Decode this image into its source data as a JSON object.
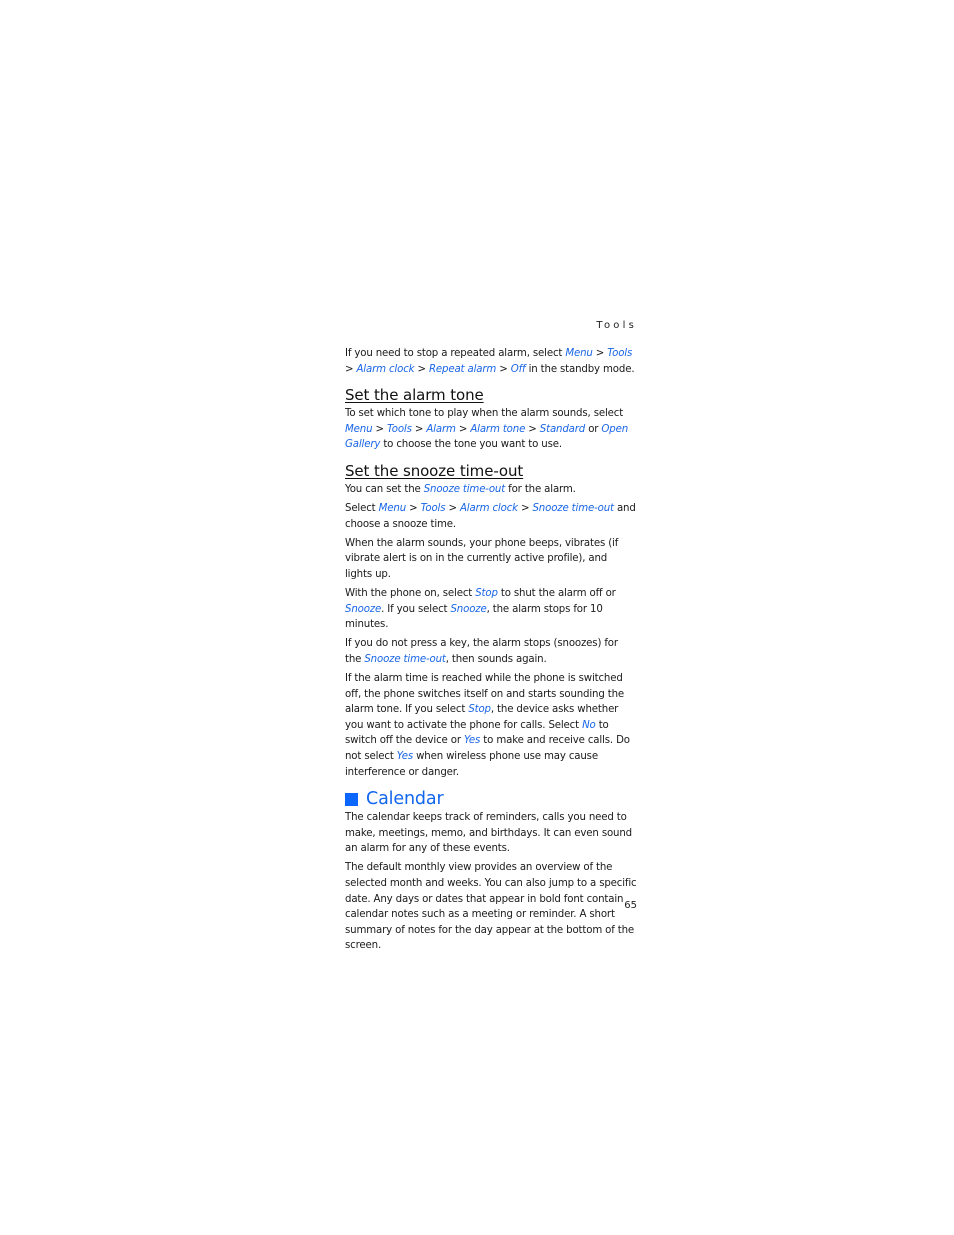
{
  "running_head": "Tools",
  "page_number": "65",
  "link_color": "#1a66e6",
  "accent_color": "#0a66ff",
  "intro": [
    {
      "t": "If you need to stop a repeated alarm, select "
    },
    {
      "l": "Menu"
    },
    {
      "t": " > "
    },
    {
      "l": "Tools"
    },
    {
      "t": " > "
    },
    {
      "l": "Alarm clock"
    },
    {
      "t": " > "
    },
    {
      "l": "Repeat alarm"
    },
    {
      "t": " > "
    },
    {
      "l": "Off"
    },
    {
      "t": " in the standby mode."
    }
  ],
  "sections": [
    {
      "heading": "Set the alarm tone",
      "paragraphs": [
        [
          {
            "t": "To set which tone to play when the alarm sounds, select "
          },
          {
            "l": "Menu"
          },
          {
            "t": " > "
          },
          {
            "l": "Tools"
          },
          {
            "t": " > "
          },
          {
            "l": "Alarm"
          },
          {
            "t": " > "
          },
          {
            "l": "Alarm tone"
          },
          {
            "t": " > "
          },
          {
            "l": "Standard"
          },
          {
            "t": " or "
          },
          {
            "l": "Open Gallery"
          },
          {
            "t": " to choose the tone you want to use."
          }
        ]
      ]
    },
    {
      "heading": "Set the snooze time-out",
      "paragraphs": [
        [
          {
            "t": "You can set the "
          },
          {
            "l": "Snooze time-out"
          },
          {
            "t": " for the alarm."
          }
        ],
        [
          {
            "t": "Select "
          },
          {
            "l": "Menu"
          },
          {
            "t": " > "
          },
          {
            "l": "Tools"
          },
          {
            "t": " > "
          },
          {
            "l": "Alarm clock"
          },
          {
            "t": " > "
          },
          {
            "l": "Snooze time-out"
          },
          {
            "t": " and choose a snooze time."
          }
        ],
        [
          {
            "t": "When the alarm sounds, your phone beeps, vibrates (if vibrate alert is on in the currently active profile), and lights up."
          }
        ],
        [
          {
            "t": "With the phone on, select "
          },
          {
            "l": "Stop"
          },
          {
            "t": " to shut the alarm off or "
          },
          {
            "l": "Snooze"
          },
          {
            "t": ". If you select "
          },
          {
            "l": "Snooze"
          },
          {
            "t": ", the alarm stops for 10 minutes."
          }
        ],
        [
          {
            "t": "If you do not press a key, the alarm stops (snoozes) for the "
          },
          {
            "l": "Snooze time-out"
          },
          {
            "t": ", then sounds again."
          }
        ],
        [
          {
            "t": "If the alarm time is reached while the phone is switched off, the phone switches itself on and starts sounding the alarm tone. If you select "
          },
          {
            "l": "Stop"
          },
          {
            "t": ", the device asks whether you want to activate the phone for calls. Select "
          },
          {
            "l": "No"
          },
          {
            "t": " to switch off the device or "
          },
          {
            "l": "Yes"
          },
          {
            "t": " to make and receive calls. Do not select "
          },
          {
            "l": "Yes"
          },
          {
            "t": " when wireless phone use may cause interference or danger."
          }
        ]
      ]
    }
  ],
  "calendar": {
    "heading": "Calendar",
    "paragraphs": [
      "The calendar keeps track of reminders, calls you need to make, meetings, memo, and birthdays. It can even sound an alarm for any of these events.",
      "The default monthly view provides an overview of the selected month and weeks. You can also jump to a specific date. Any days or dates that appear in bold font contain calendar notes such as a meeting or reminder. A short summary of notes for the day appear at the bottom of the screen."
    ]
  }
}
